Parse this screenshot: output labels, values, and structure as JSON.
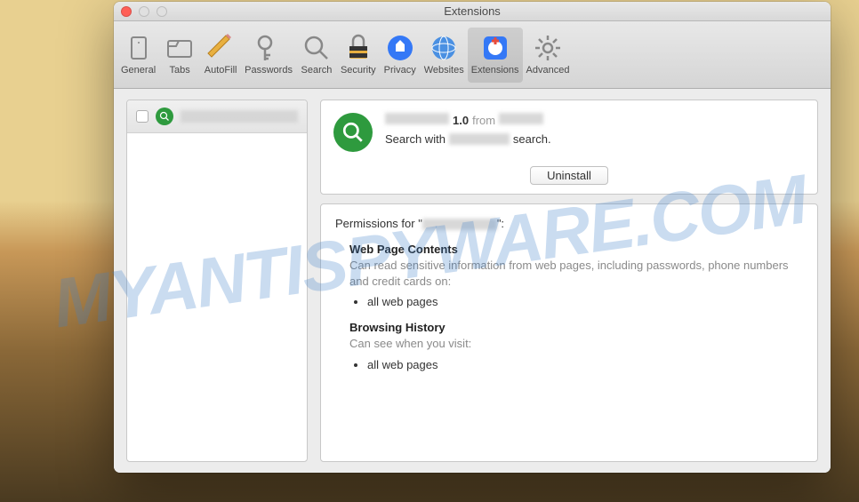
{
  "window": {
    "title": "Extensions"
  },
  "toolbar": {
    "items": [
      {
        "label": "General"
      },
      {
        "label": "Tabs"
      },
      {
        "label": "AutoFill"
      },
      {
        "label": "Passwords"
      },
      {
        "label": "Search"
      },
      {
        "label": "Security"
      },
      {
        "label": "Privacy"
      },
      {
        "label": "Websites"
      },
      {
        "label": "Extensions"
      },
      {
        "label": "Advanced"
      }
    ],
    "active_index": 8
  },
  "sidebar": {
    "items": [
      {
        "name_redacted": true,
        "checked": false
      }
    ]
  },
  "detail": {
    "name_redacted": true,
    "version": "1.0",
    "from_label": "from",
    "author_redacted": true,
    "desc_prefix": "Search with",
    "desc_mid_redacted": true,
    "desc_suffix": "search.",
    "uninstall_label": "Uninstall"
  },
  "permissions": {
    "title_prefix": "Permissions for \"",
    "title_name_redacted": true,
    "title_suffix": "\":",
    "sections": [
      {
        "heading": "Web Page Contents",
        "desc": "Can read sensitive information from web pages, including passwords, phone numbers and credit cards on:",
        "items": [
          "all web pages"
        ]
      },
      {
        "heading": "Browsing History",
        "desc": "Can see when you visit:",
        "items": [
          "all web pages"
        ]
      }
    ]
  },
  "watermark": "MYANTISPYWARE.COM"
}
